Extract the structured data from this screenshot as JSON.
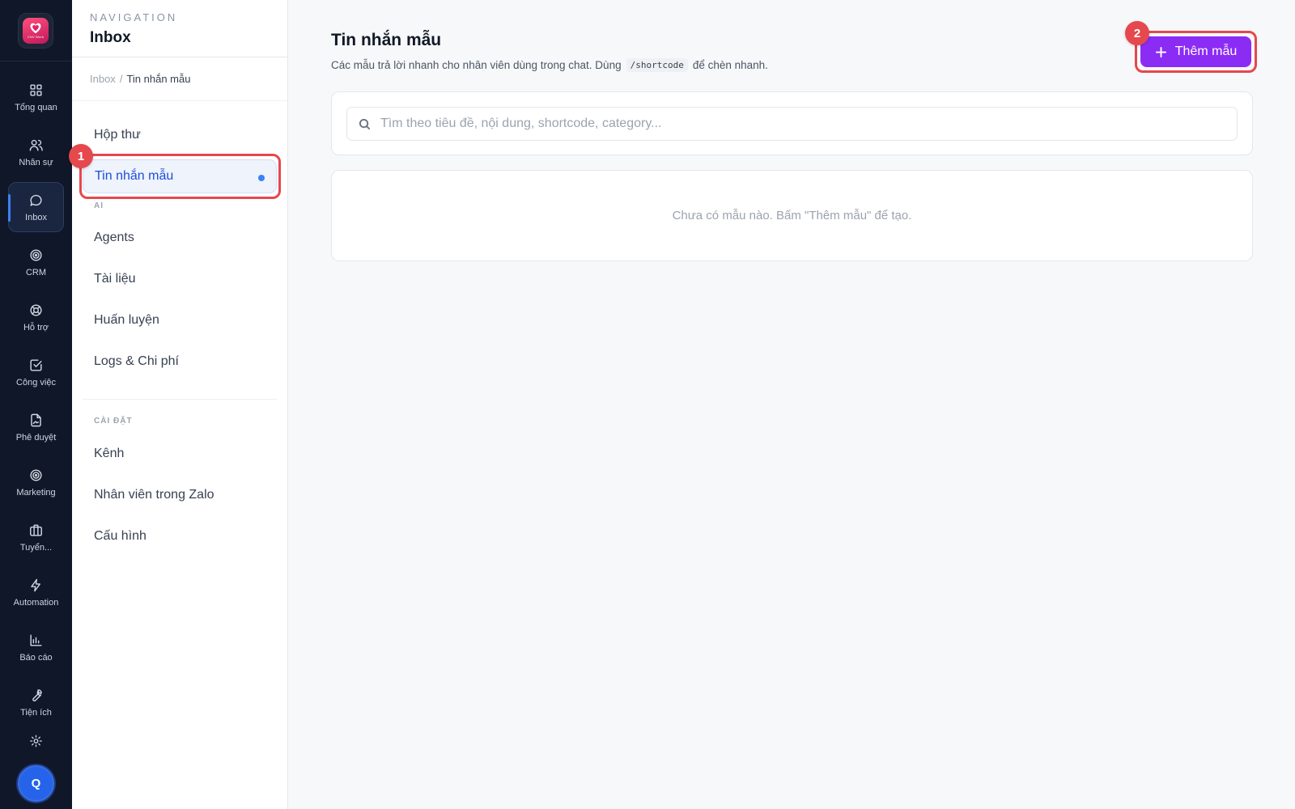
{
  "rail": {
    "logo_text": "CNV Work",
    "items": [
      {
        "label": "Tổng quan",
        "icon": "grid-icon"
      },
      {
        "label": "Nhân sự",
        "icon": "users-icon"
      },
      {
        "label": "Inbox",
        "icon": "chat-bubble-icon",
        "active": true
      },
      {
        "label": "CRM",
        "icon": "target-icon"
      },
      {
        "label": "Hỗ trợ",
        "icon": "lifebuoy-icon"
      },
      {
        "label": "Công việc",
        "icon": "check-square-icon"
      },
      {
        "label": "Phê duyệt",
        "icon": "file-sign-icon"
      },
      {
        "label": "Marketing",
        "icon": "target-icon"
      },
      {
        "label": "Tuyển...",
        "icon": "briefcase-icon"
      },
      {
        "label": "Automation",
        "icon": "lightning-icon"
      },
      {
        "label": "Báo cáo",
        "icon": "bar-chart-icon"
      },
      {
        "label": "Tiện ích",
        "icon": "wrench-icon"
      },
      {
        "label": "",
        "icon": "gear-icon"
      }
    ],
    "avatar_initial": "Q"
  },
  "nav": {
    "kicker": "NAVIGATION",
    "title": "Inbox",
    "breadcrumb": {
      "parent": "Inbox",
      "separator": "/",
      "current": "Tin nhắn mẫu"
    },
    "items": [
      {
        "label": "Hộp thư"
      },
      {
        "label": "Tin nhắn mẫu",
        "active": true
      },
      {
        "label": "Agents"
      },
      {
        "label": "Tài liệu"
      },
      {
        "label": "Huấn luyện"
      },
      {
        "label": "Logs & Chi phí"
      },
      {
        "label": "Kênh"
      },
      {
        "label": "Nhân viên trong Zalo"
      },
      {
        "label": "Cấu hình"
      }
    ],
    "sections": {
      "ai": "AI",
      "settings": "CÀI ĐẶT"
    }
  },
  "main": {
    "title": "Tin nhắn mẫu",
    "desc_before": "Các mẫu trả lời nhanh cho nhân viên dùng trong chat. Dùng",
    "desc_code": "/shortcode",
    "desc_after": "để chèn nhanh.",
    "add_button": "Thêm mẫu",
    "search_placeholder": "Tìm theo tiêu đề, nội dung, shortcode, category...",
    "empty_text": "Chưa có mẫu nào. Bấm \"Thêm mẫu\" để tạo."
  },
  "annotations": {
    "first": "1",
    "second": "2"
  },
  "colors": {
    "accent": "#8b2cf5",
    "highlight": "#e5484d",
    "active_blue": "#1d4ed8",
    "rail_bg": "#0f1729"
  }
}
